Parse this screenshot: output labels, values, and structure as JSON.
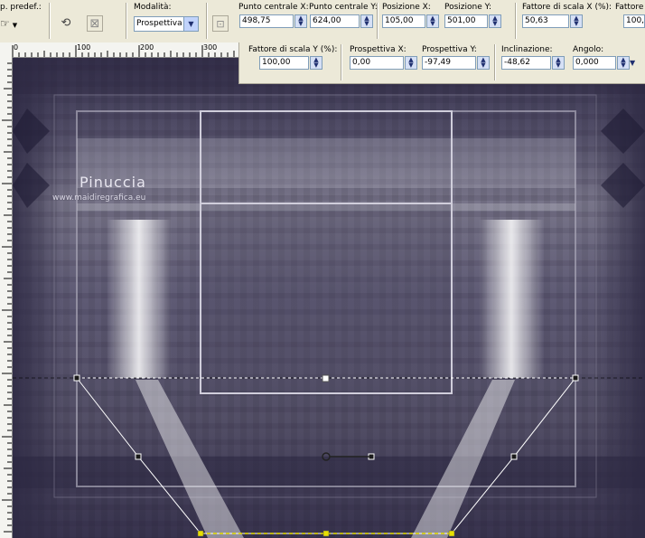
{
  "toolbar": {
    "preset_label": "p. predef.:",
    "mode_label": "Modalità:",
    "mode_value": "Prospettiva",
    "center_x_label": "Punto centrale X:",
    "center_x_value": "498,75",
    "center_y_label": "Punto centrale Y:",
    "center_y_value": "624,00",
    "pos_x_label": "Posizione X:",
    "pos_x_value": "105,00",
    "pos_y_label": "Posizione Y:",
    "pos_y_value": "501,00",
    "scale_x_label": "Fattore di scala X (%):",
    "scale_x_value": "50,63",
    "scale_cut_label": "Fattore",
    "scale_cut_value": "100,"
  },
  "toolbar2": {
    "scale_y_label": "Fattore di scala Y (%):",
    "scale_y_value": "100,00",
    "persp_x_label": "Prospettiva X:",
    "persp_x_value": "0,00",
    "persp_y_label": "Prospettiva Y:",
    "persp_y_value": "-97,49",
    "incl_label": "Inclinazione:",
    "incl_value": "-48,62",
    "angle_label": "Angolo:",
    "angle_value": "0,000"
  },
  "ruler": {
    "ticks": [
      "0",
      "100",
      "200",
      "300"
    ]
  },
  "canvas": {
    "watermark_name": "Pinuccia",
    "watermark_url": "www.maidiregrafica.eu"
  },
  "colors": {
    "image_dark": "#3a3550",
    "image_mid": "#6e6a82",
    "image_light": "#b8b6c4",
    "handle_yellow": "#e8e000"
  }
}
